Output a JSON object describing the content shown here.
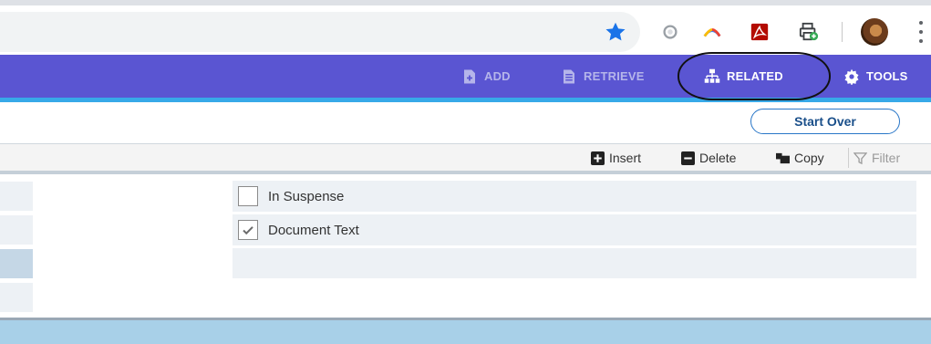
{
  "browser": {
    "address_value": "",
    "icons": {
      "bookmark": "star-icon",
      "extension_1": "circle-extension-icon",
      "extension_2": "arc-extension-icon",
      "extension_3": "pdf-icon",
      "extension_4": "printer-icon",
      "profile": "avatar",
      "menu": "kebab-menu-icon"
    },
    "colors": {
      "star": "#1a73e8",
      "pdf": "#b30b00",
      "print_badge": "#34a853"
    }
  },
  "toolbar": {
    "add_label": "ADD",
    "retrieve_label": "RETRIEVE",
    "related_label": "RELATED",
    "tools_label": "TOOLS",
    "colors": {
      "background": "#5a55d2",
      "accent_underline": "#37a9e8",
      "disabled_text": "#b5b5ea"
    }
  },
  "actions": {
    "start_over_label": "Start Over"
  },
  "grid_toolbar": {
    "insert_label": "Insert",
    "delete_label": "Delete",
    "copy_label": "Copy",
    "filter_label": "Filter"
  },
  "rows": [
    {
      "label": "In Suspense",
      "checked": false
    },
    {
      "label": "Document Text",
      "checked": true
    }
  ]
}
